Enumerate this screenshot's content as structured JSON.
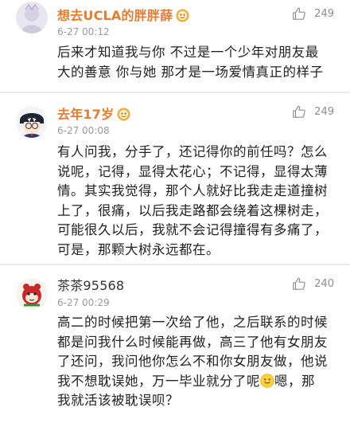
{
  "comments": [
    {
      "username": "想去UCLA的胖胖薛",
      "time": "6-27 00:12",
      "likes": "249",
      "lines": [
        "后来才知道我与你 不过是一个少年对朋友最",
        "大的善意 你与她 那才是一场爱情真正的样子"
      ]
    },
    {
      "username": "去年17岁",
      "time": "6-27 00:08",
      "likes": "249",
      "lines": [
        "有人问我，分手了，还记得你的前任吗？怎么",
        "说呢，记得，显得太花心；不记得，显得太薄",
        "情。其实我觉得，那个人就好比我走走道撞树",
        "上了，很痛，以后我走路都会绕着这棵树走，",
        "可能很久以后，我就不会记得撞得有多痛了，",
        "可是，那颗大树永远都在。"
      ]
    },
    {
      "username": "茶茶95568",
      "time": "6-27 00:29",
      "likes": "240",
      "lines": [
        "高二的时候把第一次给了他，之后联系的时候",
        "都是问我什么时候能再做，高三了他有女朋友",
        "了还问，我问他你怎么不和你女朋友做，他说",
        "我不想耽误她，万一毕业就分了呢",
        "嗯，那",
        "我就活该被耽误呗？"
      ]
    }
  ],
  "colors": {
    "username": "#e67c2e",
    "time": "#9a9a9a",
    "likes": "#8d8d8d",
    "separator": "#ececec"
  },
  "icons": {
    "like": "thumbs-up-icon",
    "badge": "vip-badge-icon",
    "inline_emoji": "smile-emoji-icon"
  }
}
